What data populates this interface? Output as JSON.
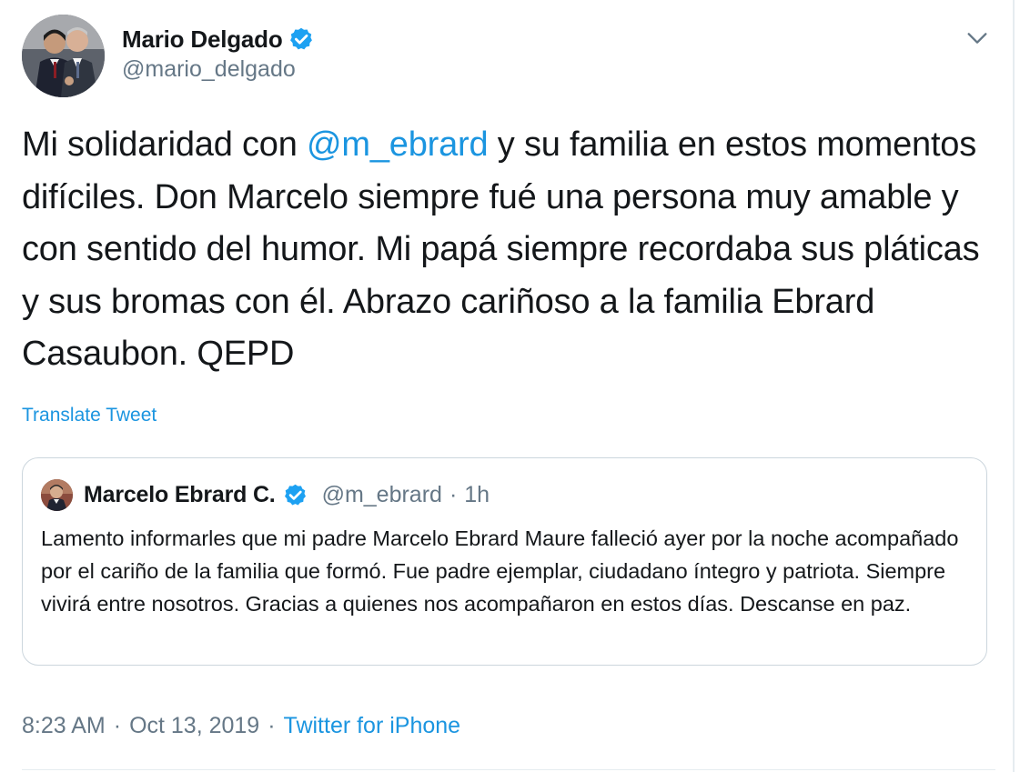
{
  "author": {
    "name": "Mario Delgado",
    "handle": "@mario_delgado",
    "verified_icon": "verified-badge-icon"
  },
  "menu": {
    "icon": "chevron-down-icon"
  },
  "tweet": {
    "text_before_mention": "Mi solidaridad con ",
    "mention": "@m_ebrard",
    "text_after_mention": " y su familia en estos momentos difíciles. Don Marcelo siempre fué una persona muy amable y con sentido del humor. Mi papá siempre recordaba sus pláticas y sus bromas con él. Abrazo cariñoso a la familia Ebrard Casaubon. QEPD",
    "translate_label": "Translate Tweet"
  },
  "quoted_tweet": {
    "author_name": "Marcelo Ebrard C.",
    "handle": "@m_ebrard",
    "separator": "·",
    "time": "1h",
    "text": "Lamento informarles que mi padre Marcelo Ebrard Maure falleció ayer por la noche acompañado por el cariño de la familia que formó. Fue padre ejemplar, ciudadano íntegro y patriota. Siempre vivirá entre  nosotros. Gracias a quienes nos acompañaron en estos días. Descanse en paz."
  },
  "footer": {
    "time": "8:23 AM",
    "separator_1": "·",
    "date": "Oct 13, 2019",
    "separator_2": "·",
    "source": "Twitter for iPhone"
  },
  "colors": {
    "accent": "#1b95e0",
    "secondary_text": "#657786",
    "primary_text": "#14171a",
    "border": "#ccd6dd"
  }
}
